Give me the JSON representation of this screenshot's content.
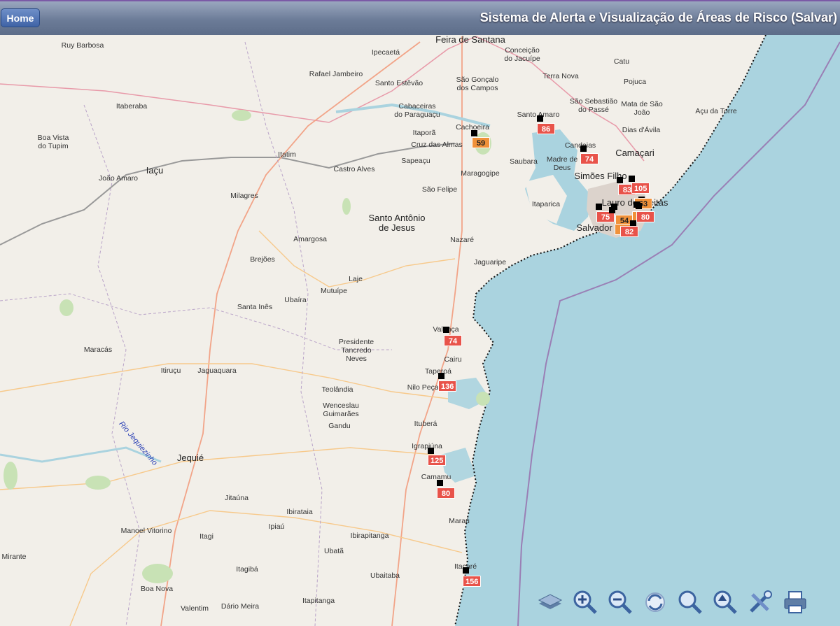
{
  "header": {
    "home_label": "Home",
    "title": "Sistema de Alerta e Visualização de Áreas de Risco (Salvar)"
  },
  "places": [
    {
      "name": "Feira de Santana",
      "big": true
    },
    {
      "name": "Ruy Barbosa"
    },
    {
      "name": "Ipecaetá"
    },
    {
      "name": "Conceição\ndo Jacuípe"
    },
    {
      "name": "Catu"
    },
    {
      "name": "Rafael Jambeiro"
    },
    {
      "name": "Terra Nova"
    },
    {
      "name": "Santo Estêvão"
    },
    {
      "name": "São Gonçalo\ndos Campos"
    },
    {
      "name": "Pojuca"
    },
    {
      "name": "Itaberaba"
    },
    {
      "name": "Cabaceiras\ndo Paraguaçu"
    },
    {
      "name": "São Sebastião\ndo Passé"
    },
    {
      "name": "Mata de São\nJoão"
    },
    {
      "name": "Açu da Torre"
    },
    {
      "name": "Santo Amaro"
    },
    {
      "name": "Cachoeira"
    },
    {
      "name": "Boa Vista\ndo Tupim"
    },
    {
      "name": "Itaporã"
    },
    {
      "name": "Dias d'Ávila"
    },
    {
      "name": "Cruz das Almas"
    },
    {
      "name": "Candeias"
    },
    {
      "name": "Camaçari",
      "big": true
    },
    {
      "name": "Itatim"
    },
    {
      "name": "Saubara"
    },
    {
      "name": "Madre de\nDeus"
    },
    {
      "name": "Sapeaçu"
    },
    {
      "name": "Iaçu",
      "big": true
    },
    {
      "name": "Castro Alves"
    },
    {
      "name": "Maragogipe"
    },
    {
      "name": "João Amaro"
    },
    {
      "name": "Simões Filho",
      "big": true
    },
    {
      "name": "São Felipe"
    },
    {
      "name": "Milagres"
    },
    {
      "name": "Lauro de Freitas",
      "big": true
    },
    {
      "name": "Itaparica"
    },
    {
      "name": "Santo Antônio\nde Jesus",
      "big": true
    },
    {
      "name": "Salvador",
      "big": true
    },
    {
      "name": "Amargosa"
    },
    {
      "name": "Nazaré"
    },
    {
      "name": "Brejões"
    },
    {
      "name": "Jaguaripe"
    },
    {
      "name": "Laje"
    },
    {
      "name": "Mutuípe"
    },
    {
      "name": "Ubaíra"
    },
    {
      "name": "Santa Inês"
    },
    {
      "name": "Valença"
    },
    {
      "name": "Presidente\nTancredo\nNeves"
    },
    {
      "name": "Maracás"
    },
    {
      "name": "Cairu"
    },
    {
      "name": "Itiruçu"
    },
    {
      "name": "Jaguaquara"
    },
    {
      "name": "Taperoá"
    },
    {
      "name": "Nilo Peçanha"
    },
    {
      "name": "Teolândia"
    },
    {
      "name": "Wenceslau\nGuimarães"
    },
    {
      "name": "Gandu"
    },
    {
      "name": "Ituberá"
    },
    {
      "name": "Igrapiúna"
    },
    {
      "name": "Jequié",
      "big": true
    },
    {
      "name": "Camamu"
    },
    {
      "name": "Jitaúna"
    },
    {
      "name": "Ibirataia"
    },
    {
      "name": "Maraú"
    },
    {
      "name": "Manoel Vitorino"
    },
    {
      "name": "Itagi"
    },
    {
      "name": "Ipiaú"
    },
    {
      "name": "Ibirapitanga"
    },
    {
      "name": "Mirante"
    },
    {
      "name": "Ubatã"
    },
    {
      "name": "Itacaré"
    },
    {
      "name": "Itagibá"
    },
    {
      "name": "Ubaitaba"
    },
    {
      "name": "Boa Nova"
    },
    {
      "name": "Valentim"
    },
    {
      "name": "Dário Meira"
    },
    {
      "name": "Itapitanga"
    }
  ],
  "river_label": "Rio Jequiezinho",
  "alerts": [
    {
      "value": "86",
      "color": "#e8534a"
    },
    {
      "value": "59",
      "color": "#f0913a"
    },
    {
      "value": "74",
      "color": "#e8534a"
    },
    {
      "value": "83",
      "color": "#e8534a"
    },
    {
      "value": "105",
      "color": "#e8534a"
    },
    {
      "value": "63",
      "color": "#f0913a"
    },
    {
      "value": "75",
      "color": "#e8534a"
    },
    {
      "value": "54",
      "color": "#f0913a"
    },
    {
      "value": "6",
      "color": "#f0913a"
    },
    {
      "value": "80",
      "color": "#e8534a"
    },
    {
      "value": "6",
      "color": "#f0913a"
    },
    {
      "value": "82",
      "color": "#e8534a"
    },
    {
      "value": "74",
      "color": "#e8534a"
    },
    {
      "value": "136",
      "color": "#e8534a"
    },
    {
      "value": "125",
      "color": "#e8534a"
    },
    {
      "value": "80",
      "color": "#e8534a"
    },
    {
      "value": "156",
      "color": "#e8534a"
    }
  ],
  "tools": [
    {
      "name": "layers-icon"
    },
    {
      "name": "zoom-in-icon"
    },
    {
      "name": "zoom-out-icon"
    },
    {
      "name": "refresh-icon"
    },
    {
      "name": "zoom-extent-icon"
    },
    {
      "name": "zoom-previous-icon"
    },
    {
      "name": "settings-tools-icon"
    },
    {
      "name": "print-icon"
    }
  ],
  "colors": {
    "sea": "#aad3df",
    "land": "#f2efe9",
    "alert_high": "#e8534a",
    "alert_medium": "#f0913a"
  }
}
